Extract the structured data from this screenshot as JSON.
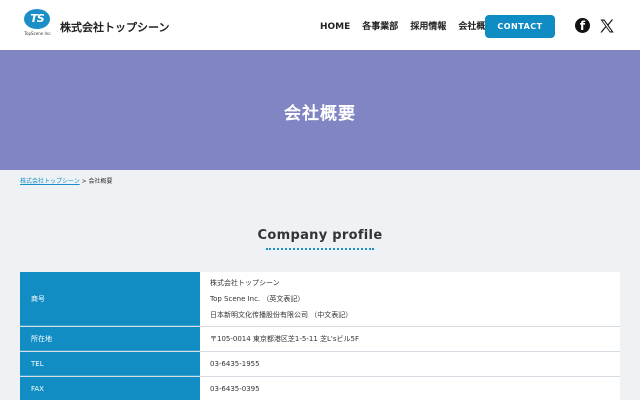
{
  "header": {
    "logo_text": "TS",
    "logo_sub": "TopScene Inc.",
    "company_name": "株式会社トップシーン",
    "nav": [
      {
        "label": "HOME"
      },
      {
        "label": "各事業部"
      },
      {
        "label": "採用情報"
      },
      {
        "label": "会社概要"
      }
    ],
    "contact_label": "CONTACT",
    "facebook_glyph": "f"
  },
  "hero": {
    "title": "会社概要"
  },
  "breadcrumb": {
    "home": "株式会社トップシーン",
    "separator": " > ",
    "current": "会社概要"
  },
  "section": {
    "title": "Company profile"
  },
  "profile_table": [
    {
      "label": "商号",
      "lines": [
        "株式会社トップシーン",
        "Top Scene Inc. （英文表記）",
        "日本新明文化传播股份有限公司 （中文表記）"
      ]
    },
    {
      "label": "所在地",
      "lines": [
        "〒105-0014 東京都港区芝1-5-11 芝L'sビル5F"
      ]
    },
    {
      "label": "TEL",
      "lines": [
        "03-6435-1955"
      ]
    },
    {
      "label": "FAX",
      "lines": [
        "03-6435-0395"
      ]
    }
  ],
  "colors": {
    "brand_blue": "#118dc4",
    "hero_purple": "#8285c3",
    "page_bg": "#eef2f4"
  }
}
